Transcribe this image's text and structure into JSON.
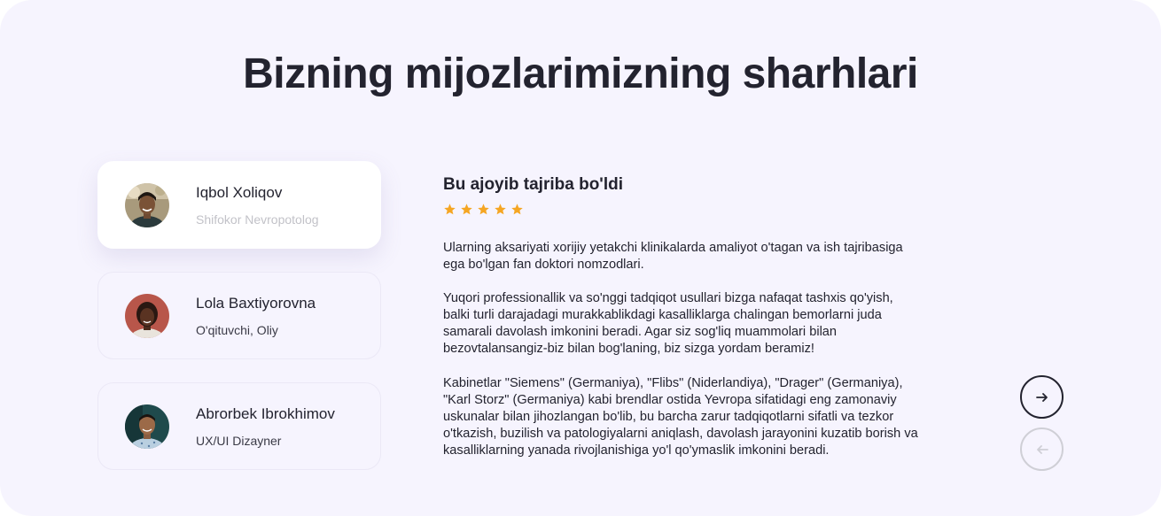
{
  "section": {
    "title": "Bizning mijozlarimizning sharhlari"
  },
  "testimonials": [
    {
      "name": "Iqbol Xoliqov",
      "role": "Shifokor Nevropotolog",
      "active": true
    },
    {
      "name": "Lola Baxtiyorovna",
      "role": "O'qituvchi, Oliy",
      "active": false
    },
    {
      "name": "Abrorbek Ibrokhimov",
      "role": "UX/UI Dizayner",
      "active": false
    }
  ],
  "review": {
    "title": "Bu ajoyib tajriba bo'ldi",
    "rating": 5,
    "star_color": "#f5a623",
    "paragraphs": [
      "Ularning aksariyati xorijiy yetakchi klinikalarda amaliyot o'tagan va ish tajribasiga ega bo'lgan fan doktori nomzodlari.",
      "Yuqori professionallik va so'nggi tadqiqot usullari bizga nafaqat tashxis qo'yish, balki turli darajadagi murakkablikdagi kasalliklarga chalingan bemorlarni juda samarali davolash imkonini beradi. Agar siz sog'liq muammolari bilan bezovtalansangiz-biz bilan bog'laning, biz sizga yordam beramiz!",
      "Kabinetlar \"Siemens\" (Germaniya), \"Flibs\" (Niderlandiya), \"Drager\" (Germaniya), \"Karl Storz\" (Germaniya) kabi brendlar ostida Yevropa sifatidagi eng zamonaviy uskunalar bilan jihozlangan bo'lib, bu barcha zarur tadqiqotlarni sifatli va tezkor o'tkazish, buzilish va patologiyalarni aniqlash, davolash jarayonini kuzatib borish va kasalliklarning yanada rivojlanishiga yo'l qo'ymaslik imkonini beradi."
    ]
  },
  "navigation": {
    "next_icon": "arrow-right-icon",
    "prev_icon": "arrow-left-icon",
    "prev_disabled": true
  },
  "colors": {
    "background": "#f6f4fe",
    "text": "#23232f",
    "muted": "#c2c2c8"
  }
}
